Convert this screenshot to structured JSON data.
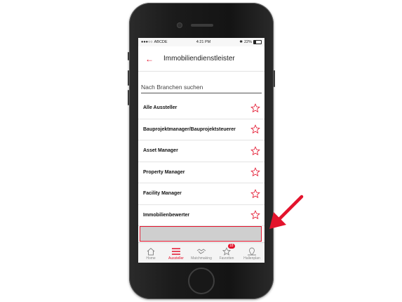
{
  "status_bar": {
    "carrier": "ABCDE",
    "time": "4:21 PM",
    "battery": "22%"
  },
  "header": {
    "title": "Immobiliendienstleister"
  },
  "search": {
    "placeholder": "Nach Branchen suchen"
  },
  "list": {
    "items": [
      {
        "label": "Alle Aussteller"
      },
      {
        "label": "Bauprojektmanager/Bauprojektsteuerer"
      },
      {
        "label": "Asset Manager"
      },
      {
        "label": "Property Manager"
      },
      {
        "label": "Facility Manager"
      },
      {
        "label": "Immobilienbewerter"
      }
    ]
  },
  "tabs": [
    {
      "label": "Home",
      "icon": "home-icon",
      "active": false
    },
    {
      "label": "Aussteller",
      "icon": "menu-icon",
      "active": true
    },
    {
      "label": "Matchmaking",
      "icon": "handshake-icon",
      "active": false
    },
    {
      "label": "Favoriten",
      "icon": "star-icon",
      "active": false,
      "badge": "18"
    },
    {
      "label": "Hallenplan",
      "icon": "map-pin-icon",
      "active": false
    }
  ],
  "colors": {
    "accent": "#e3132c",
    "divider": "#e4e4e4",
    "placeholder_box": "#cfcfcf"
  }
}
